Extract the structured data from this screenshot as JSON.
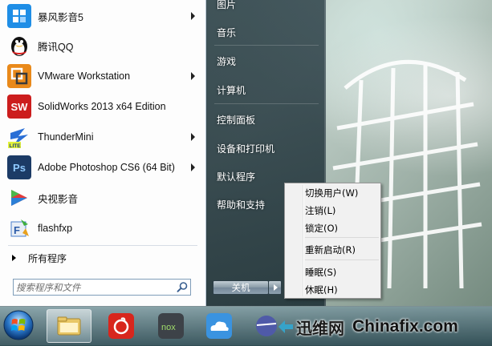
{
  "programs": [
    {
      "label": "暴风影音5",
      "icon": "baofeng-icon",
      "color": "#1f8ee6",
      "has_submenu": true
    },
    {
      "label": "腾讯QQ",
      "icon": "qq-penguin-icon",
      "color": "#111111",
      "has_submenu": false
    },
    {
      "label": "VMware Workstation",
      "icon": "vmware-icon",
      "color": "#e9891a",
      "has_submenu": true
    },
    {
      "label": "SolidWorks 2013 x64 Edition",
      "icon": "solidworks-icon",
      "color": "#cc1d1d",
      "has_submenu": false
    },
    {
      "label": "ThunderMini",
      "icon": "thunder-icon",
      "color": "#2a6fd6",
      "has_submenu": true
    },
    {
      "label": "Adobe Photoshop CS6 (64 Bit)",
      "icon": "photoshop-icon",
      "color": "#1c3b66",
      "has_submenu": true
    },
    {
      "label": "央视影音",
      "icon": "cctv-icon",
      "color": "#e43a3a",
      "has_submenu": false
    },
    {
      "label": "flashfxp",
      "icon": "flashfxp-icon",
      "color": "#4a7fcc",
      "has_submenu": false
    }
  ],
  "all_programs": "所有程序",
  "search": {
    "placeholder": "搜索程序和文件"
  },
  "right_items": [
    "图片",
    "音乐",
    "游戏",
    "计算机",
    "控制面板",
    "设备和打印机",
    "默认程序",
    "帮助和支持"
  ],
  "shutdown": {
    "label": "关机"
  },
  "power_menu": {
    "group1": [
      "切换用户(W)",
      "注销(L)",
      "锁定(O)"
    ],
    "group2": [
      "重新启动(R)"
    ],
    "group3": [
      "睡眠(S)",
      "休眠(H)"
    ]
  },
  "taskbar": {
    "items": [
      "explorer-folder-icon",
      "netease-music-icon",
      "nox-player-icon",
      "cloud-drive-icon",
      "media-icon"
    ]
  },
  "watermark": {
    "cn": "迅维网",
    "en": "Chinafix.com"
  },
  "colors": {
    "accent": "#1f8ee6",
    "right_pane": "#283c44",
    "taskbar": "#3e6470"
  }
}
